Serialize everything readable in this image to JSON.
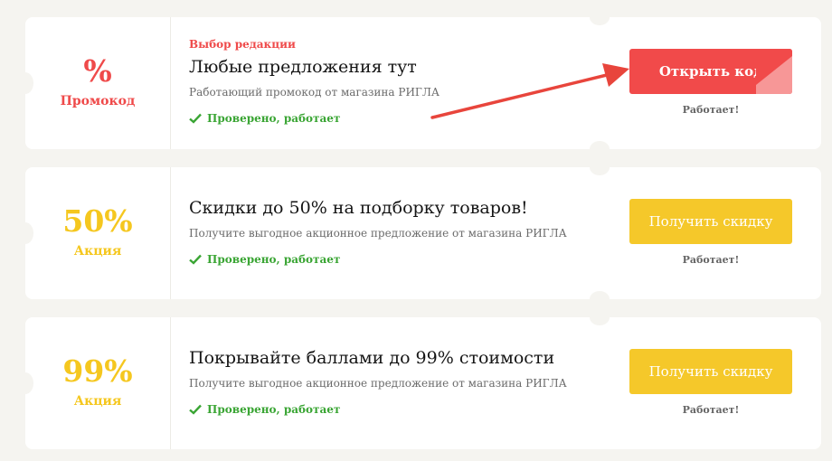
{
  "offers": [
    {
      "big": "%",
      "kind": "Промокод",
      "editor_label": "Выбор редакции",
      "title": "Любые предложения тут",
      "description": "Работающий промокод от магазина РИГЛА",
      "verified": "Проверено, работает",
      "button": "Открыть код",
      "status": "Работает!",
      "accent": "#ef4a4a"
    },
    {
      "big": "50%",
      "kind": "Акция",
      "title": "Скидки до 50% на подборку товаров!",
      "description": "Получите выгодное акционное предложение от магазина РИГЛА",
      "verified": "Проверено, работает",
      "button": "Получить скидку",
      "status": "Работает!",
      "accent": "#f5c71f"
    },
    {
      "big": "99%",
      "kind": "Акция",
      "title": "Покрывайте баллами до 99% стоимости",
      "description": "Получите выгодное акционное предложение от магазина РИГЛА",
      "verified": "Проверено, работает",
      "button": "Получить скидку",
      "status": "Работает!",
      "accent": "#f5c71f"
    }
  ],
  "icons": {
    "verified": "check-icon",
    "annotation": "red-arrow-icon"
  },
  "colors": {
    "red": "#ef4a4a",
    "yellow": "#f5c71f",
    "green": "#3aa534",
    "background": "#f5f4f0"
  }
}
